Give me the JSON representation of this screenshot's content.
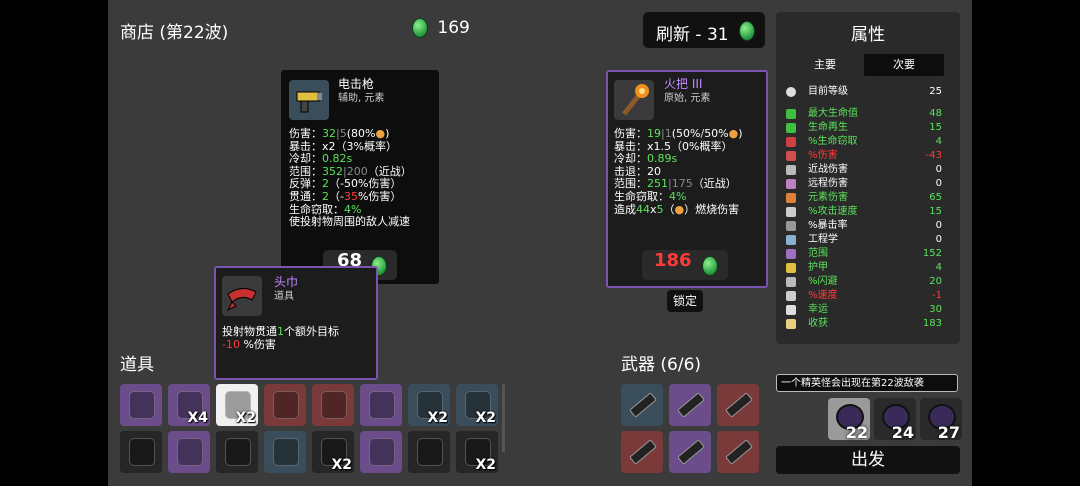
{
  "shop": {
    "title": "商店 (第22波)",
    "materials": "169",
    "reroll": "刷新 - 31"
  },
  "stats": {
    "title": "属性",
    "tabs": [
      "主要",
      "次要"
    ],
    "level_label": "目前等级",
    "level_value": "25",
    "rows": [
      {
        "name": "最大生命值",
        "value": "48",
        "color": "#5be35b",
        "icon": "heart-icon",
        "icolor": "#3fbf3f"
      },
      {
        "name": "生命再生",
        "value": "15",
        "color": "#5be35b",
        "icon": "heart-plus-icon",
        "icolor": "#3fbf3f"
      },
      {
        "name": "%生命窃取",
        "value": "4",
        "color": "#5be35b",
        "icon": "fangs-icon",
        "icolor": "#d04040"
      },
      {
        "name": "%伤害",
        "value": "-43",
        "color": "#ff3a3a",
        "icon": "damage-icon",
        "icolor": "#d05050"
      },
      {
        "name": "近战伤害",
        "value": "0",
        "color": "#ffffff",
        "icon": "sword-icon",
        "icolor": "#bbbbbb"
      },
      {
        "name": "远程伤害",
        "value": "0",
        "color": "#ffffff",
        "icon": "bow-icon",
        "icolor": "#c080c0"
      },
      {
        "name": "元素伤害",
        "value": "65",
        "color": "#5be35b",
        "icon": "flame-icon",
        "icolor": "#e0803a"
      },
      {
        "name": "%攻击速度",
        "value": "15",
        "color": "#5be35b",
        "icon": "hourglass-icon",
        "icolor": "#cccccc"
      },
      {
        "name": "%暴击率",
        "value": "0",
        "color": "#ffffff",
        "icon": "crit-icon",
        "icolor": "#999999"
      },
      {
        "name": "工程学",
        "value": "0",
        "color": "#ffffff",
        "icon": "wrench-icon",
        "icolor": "#8ab0d0"
      },
      {
        "name": "范围",
        "value": "152",
        "color": "#5be35b",
        "icon": "range-icon",
        "icolor": "#a070c0"
      },
      {
        "name": "护甲",
        "value": "4",
        "color": "#5be35b",
        "icon": "shield-icon",
        "icolor": "#e0c040"
      },
      {
        "name": "%闪避",
        "value": "20",
        "color": "#5be35b",
        "icon": "dodge-icon",
        "icolor": "#bbbbbb"
      },
      {
        "name": "%速度",
        "value": "-1",
        "color": "#ff3a3a",
        "icon": "boot-icon",
        "icolor": "#cccccc"
      },
      {
        "name": "幸运",
        "value": "30",
        "color": "#5be35b",
        "icon": "clover-icon",
        "icolor": "#dddddd"
      },
      {
        "name": "收获",
        "value": "183",
        "color": "#5be35b",
        "icon": "harvest-icon",
        "icolor": "#e8d080"
      }
    ]
  },
  "card_taser": {
    "name": "电击枪",
    "tags": "辅助, 元素",
    "lines": {
      "dmg_a": "伤害：",
      "dmg_b": "32",
      "dmg_c": "|5",
      "dmg_d": "(80%",
      "dmg_e": ")",
      "crit": "暴击：x2（3%概率）",
      "cd_a": "冷却：",
      "cd_b": "0.82s",
      "range_a": "范围：",
      "range_b": "352",
      "range_c": "|200",
      "range_d": "（近战）",
      "bounce_a": "反弹：",
      "bounce_b": "2",
      "bounce_c": "（-50%伤害）",
      "pierce_a": "贯通：",
      "pierce_b": "2",
      "pierce_c": "（-",
      "pierce_d": "35",
      "pierce_e": "%伤害）",
      "ls_a": "生命窃取：",
      "ls_b": "4%",
      "effect": "使投射物周围的敌人减速"
    },
    "price": "68"
  },
  "card_bandana": {
    "name": "头巾",
    "tag": "道具",
    "line1_a": "投射物贯通",
    "line1_b": "1",
    "line1_c": "个额外目标",
    "line2_a": "-10",
    "line2_b": " %伤害"
  },
  "card_torch": {
    "name": "火把 III",
    "tags": "原始, 元素",
    "lines": {
      "dmg_a": "伤害：",
      "dmg_b": "19",
      "dmg_c": "|1",
      "dmg_d": "(50%",
      "dmg_e": "50%",
      "dmg_f": ")",
      "crit": "暴击：x1.5（0%概率）",
      "cd_a": "冷却：",
      "cd_b": "0.89s",
      "kb": "击退：20",
      "range_a": "范围：",
      "range_b": "251",
      "range_c": "|175",
      "range_d": "（近战）",
      "ls_a": "生命窃取：",
      "ls_b": "4%",
      "burn_a": "造成",
      "burn_b": "44",
      "burn_c": "x",
      "burn_d": "5",
      "burn_e": "（",
      "burn_f": "）燃烧伤害"
    },
    "price": "186",
    "lock_label": "锁定"
  },
  "inventory": {
    "items_title": "道具",
    "items": [
      {
        "icon": "candle-icon",
        "bg": "#6a4d8a",
        "qty": ""
      },
      {
        "icon": "bullet-icon",
        "bg": "#6a4d8a",
        "qty": "X4"
      },
      {
        "icon": "bandana-icon",
        "bg": "#f0f0f0",
        "qty": "X2"
      },
      {
        "icon": "mammoth-icon",
        "bg": "#7a3a3a",
        "qty": ""
      },
      {
        "icon": "ammo-icon",
        "bg": "#7a3a3a",
        "qty": ""
      },
      {
        "icon": "gift-icon",
        "bg": "#6a4d8a",
        "qty": ""
      },
      {
        "icon": "campfire-icon",
        "bg": "#3a4d5a",
        "qty": "X2"
      },
      {
        "icon": "grenade-icon",
        "bg": "#3a4d5a",
        "qty": "X2"
      },
      {
        "icon": "spider-icon",
        "bg": "#262626",
        "qty": ""
      },
      {
        "icon": "potion-icon",
        "bg": "#6a4d8a",
        "qty": ""
      },
      {
        "icon": "mine-icon",
        "bg": "#262626",
        "qty": ""
      },
      {
        "icon": "scarf-icon",
        "bg": "#3a4d5a",
        "qty": ""
      },
      {
        "icon": "bomb-icon",
        "bg": "#262626",
        "qty": "X2"
      },
      {
        "icon": "crown-icon",
        "bg": "#6a4d8a",
        "qty": ""
      },
      {
        "icon": "plaid-shirt-icon",
        "bg": "#262626",
        "qty": ""
      },
      {
        "icon": "cat-icon",
        "bg": "#262626",
        "qty": "X2"
      }
    ],
    "weapons_title": "武器 (6/6)",
    "weapons": [
      {
        "icon": "taser-icon",
        "bg": "#3a4d5a"
      },
      {
        "icon": "taser-icon",
        "bg": "#6a4d8a"
      },
      {
        "icon": "torch-icon",
        "bg": "#7a3a3a"
      },
      {
        "icon": "wand-icon",
        "bg": "#7a3a3a"
      },
      {
        "icon": "wand-icon",
        "bg": "#6a4d8a"
      },
      {
        "icon": "taser-icon",
        "bg": "#7a3a3a"
      }
    ]
  },
  "waves": {
    "notice": "一个精英怪会出现在第22波敌袭",
    "enemies": [
      "22",
      "24",
      "27"
    ],
    "go_label": "出发"
  }
}
